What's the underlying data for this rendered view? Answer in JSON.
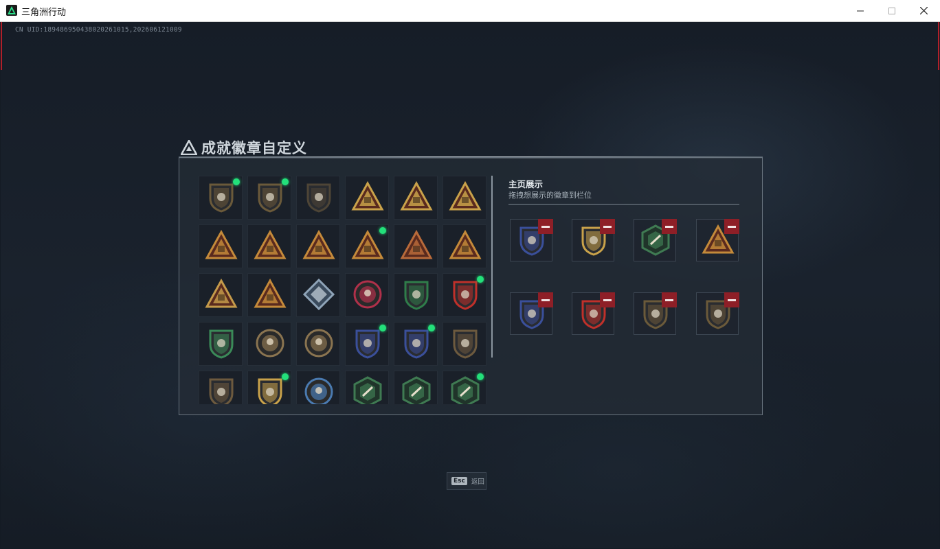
{
  "window": {
    "title": "三角洲行动",
    "controls": [
      "minimize-icon",
      "maximize-icon",
      "close-icon"
    ]
  },
  "uid": "CN UID:189486950438020261015,202606121009",
  "panel": {
    "title": "成就徽章自定义",
    "title_icon": "delta-logo-icon"
  },
  "badge_grid": {
    "rows": [
      [
        {
          "name": "shield-delta-badge",
          "shape": "shield",
          "color": "#6b5a3a",
          "new": true
        },
        {
          "name": "helicopter-shield-badge",
          "shape": "shield",
          "color": "#6b5a3a",
          "new": true
        },
        {
          "name": "diamond-shield-badge",
          "shape": "shield",
          "color": "#4e4536",
          "new": false
        },
        {
          "name": "triangle-gold-badge-1",
          "shape": "triangle",
          "color": "#c9a24a",
          "new": false
        },
        {
          "name": "triangle-gold-badge-2",
          "shape": "triangle",
          "color": "#c9a24a",
          "new": false
        },
        {
          "name": "triangle-56-badge",
          "shape": "triangle",
          "color": "#c9a24a",
          "new": false
        }
      ],
      [
        {
          "name": "triangle-soldier-badge",
          "shape": "triangle",
          "color": "#c48a3a",
          "new": false
        },
        {
          "name": "triangle-box-badge",
          "shape": "triangle",
          "color": "#c48a3a",
          "new": false
        },
        {
          "name": "triangle-tent-badge",
          "shape": "triangle",
          "color": "#c48a3a",
          "new": false
        },
        {
          "name": "triangle-helmet-badge",
          "shape": "triangle",
          "color": "#c48a3a",
          "new": true
        },
        {
          "name": "triangle-number-one-badge",
          "shape": "triangle",
          "color": "#b86a3a",
          "new": false
        },
        {
          "name": "triangle-squad-badge",
          "shape": "triangle",
          "color": "#c48a3a",
          "new": false
        }
      ],
      [
        {
          "name": "squad-gold-badge",
          "shape": "triangle",
          "color": "#c49a4a",
          "new": false
        },
        {
          "name": "triangle-rocket-badge",
          "shape": "triangle",
          "color": "#c48a3a",
          "new": false
        },
        {
          "name": "diamond-silver-badge",
          "shape": "diamond",
          "color": "#8fa4b8",
          "new": false
        },
        {
          "name": "star-medal-badge",
          "shape": "circle",
          "color": "#b0304a",
          "new": false
        },
        {
          "name": "green-shield-badge",
          "shape": "shield",
          "color": "#2f7d4a",
          "new": false
        },
        {
          "name": "royal-crest-badge",
          "shape": "shield",
          "color": "#c0302a",
          "new": true
        }
      ],
      [
        {
          "name": "green-lion-badge",
          "shape": "shield",
          "color": "#3a8a58",
          "new": false
        },
        {
          "name": "skull-round-badge",
          "shape": "circle",
          "color": "#8a7450",
          "new": false
        },
        {
          "name": "bear-round-badge",
          "shape": "circle",
          "color": "#8a7450",
          "new": false
        },
        {
          "name": "blue-crosshair-badge-1",
          "shape": "shield",
          "color": "#3a4f9a",
          "new": true
        },
        {
          "name": "blue-crosshair-badge-2",
          "shape": "shield",
          "color": "#3a4f9a",
          "new": true
        },
        {
          "name": "bronze-rifle-badge",
          "shape": "shield",
          "color": "#6d5a3e",
          "new": false
        }
      ],
      [
        {
          "name": "bronze-ring-badge",
          "shape": "shield",
          "color": "#6d5a3e",
          "new": false
        },
        {
          "name": "gold-crosshair-badge",
          "shape": "shield",
          "color": "#c9a24a",
          "new": true
        },
        {
          "name": "wolf-round-badge",
          "shape": "circle",
          "color": "#4a7ab0",
          "new": false
        },
        {
          "name": "green-hex-badge-1",
          "shape": "hex",
          "color": "#3f7a52",
          "new": false
        },
        {
          "name": "green-hex-badge-2",
          "shape": "hex",
          "color": "#3f7a52",
          "new": false
        },
        {
          "name": "green-hex-badge-3",
          "shape": "hex",
          "color": "#3f7a52",
          "new": true
        }
      ]
    ]
  },
  "showcase": {
    "title": "主页展示",
    "subtitle": "拖拽想展示的徽章到栏位",
    "slots": [
      {
        "name": "blue-crosshair-badge",
        "shape": "shield",
        "color": "#3a4f9a"
      },
      {
        "name": "gold-crosshair-badge",
        "shape": "shield",
        "color": "#c9a24a"
      },
      {
        "name": "green-hex-badge",
        "shape": "hex",
        "color": "#3f7a52"
      },
      {
        "name": "triangle-helmet-badge",
        "shape": "triangle",
        "color": "#c48a3a"
      },
      {
        "name": "blue-crosshair-badge",
        "shape": "shield",
        "color": "#3a4f9a"
      },
      {
        "name": "royal-crest-badge",
        "shape": "shield",
        "color": "#c0302a"
      },
      {
        "name": "shield-delta-badge",
        "shape": "shield",
        "color": "#6b5a3a"
      },
      {
        "name": "helicopter-shield-badge",
        "shape": "shield",
        "color": "#6b5a3a"
      }
    ],
    "remove_icon": "minus-icon"
  },
  "footer": {
    "key": "Esc",
    "label": "返回"
  }
}
